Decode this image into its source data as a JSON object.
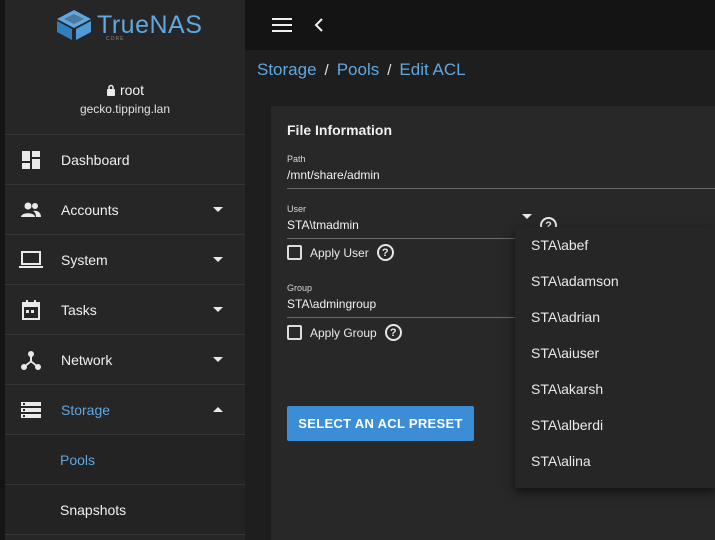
{
  "app": {
    "logo_text": "TrueNAS",
    "logo_sub": "CORE"
  },
  "user": {
    "name": "root",
    "host": "gecko.tipping.lan"
  },
  "sidebar": {
    "items": [
      {
        "label": "Dashboard",
        "icon": "dashboard-icon"
      },
      {
        "label": "Accounts",
        "icon": "accounts-icon"
      },
      {
        "label": "System",
        "icon": "laptop-icon"
      },
      {
        "label": "Tasks",
        "icon": "calendar-icon"
      },
      {
        "label": "Network",
        "icon": "network-icon"
      },
      {
        "label": "Storage",
        "icon": "storage-icon"
      }
    ],
    "subitems": [
      {
        "label": "Pools"
      },
      {
        "label": "Snapshots"
      }
    ]
  },
  "breadcrumb": {
    "items": [
      "Storage",
      "Pools",
      "Edit ACL"
    ],
    "separator": "/"
  },
  "card": {
    "title": "File Information",
    "path_label": "Path",
    "path_value": "/mnt/share/admin",
    "user_label": "User",
    "user_value": "STA\\tmadmin",
    "apply_user_label": "Apply User",
    "group_label": "Group",
    "group_value": "STA\\admingroup",
    "apply_group_label": "Apply Group",
    "preset_button": "SELECT AN ACL PRESET",
    "help_glyph": "?"
  },
  "dropdown": {
    "options": [
      "STA\\abef",
      "STA\\adamson",
      "STA\\adrian",
      "STA\\aiuser",
      "STA\\akarsh",
      "STA\\alberdi",
      "STA\\alina"
    ]
  },
  "colors": {
    "accent": "#5fa8e0",
    "button": "#3b8ed6"
  }
}
